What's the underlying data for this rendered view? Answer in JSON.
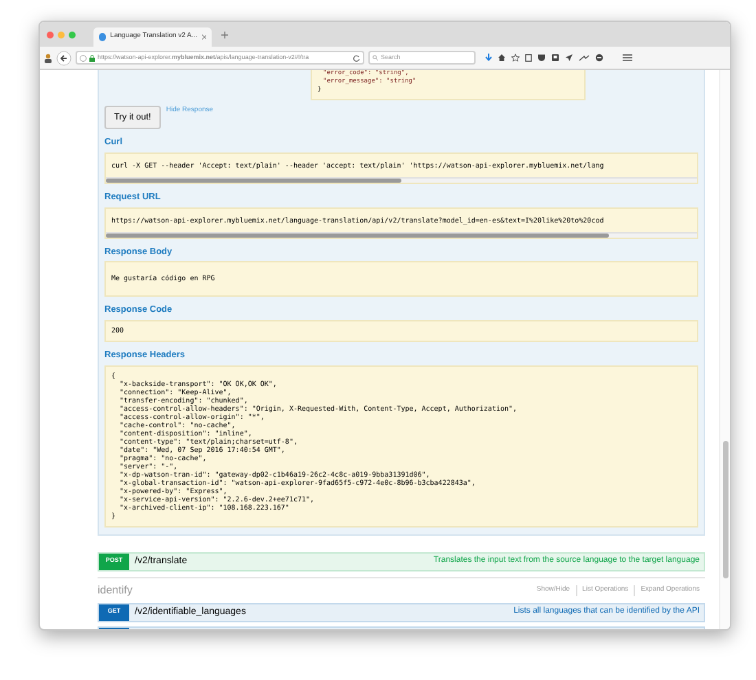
{
  "browser": {
    "tab_title": "Language Translation v2 A...",
    "url": "https://watson-api-explorer.**mybluemix.net**/apis/language-translation-v2#!/tra",
    "search": {
      "placeholder": "Search"
    }
  },
  "model_tail": [
    "\"error_code\": \"string\",",
    "\"error_message\": \"string\"",
    "}"
  ],
  "try_button": "Try it out!",
  "hide_link": "Hide Response",
  "sections": [
    {
      "label": "Curl",
      "kind": "scroll",
      "lines": [
        "curl -X GET --header 'Accept: text/plain' --header 'accept: text/plain' 'https://watson-api-explorer.mybluemix.net/lang"
      ],
      "level": 0.5
    },
    {
      "label": "Request URL",
      "kind": "scroll",
      "lines": [
        "https://watson-api-explorer.mybluemix.net/language-translation/api/v2/translate?model_id=en-es&text=I%20like%20to%20cod"
      ],
      "level": 0.85
    },
    {
      "label": "Response Body",
      "kind": "body",
      "lines": [
        "Me gustaría código en RPG"
      ]
    },
    {
      "label": "Response Code",
      "kind": "plain",
      "lines": [
        "200"
      ]
    },
    {
      "label": "Response Headers",
      "kind": "plain",
      "lines": [
        "{",
        "  \"x-backside-transport\": \"OK OK,OK OK\",",
        "  \"connection\": \"Keep-Alive\",",
        "  \"transfer-encoding\": \"chunked\",",
        "  \"access-control-allow-headers\": \"Origin, X-Requested-With, Content-Type, Accept, Authorization\",",
        "  \"access-control-allow-origin\": \"*\",",
        "  \"cache-control\": \"no-cache\",",
        "  \"content-disposition\": \"inline\",",
        "  \"content-type\": \"text/plain;charset=utf-8\",",
        "  \"date\": \"Wed, 07 Sep 2016 17:40:54 GMT\",",
        "  \"pragma\": \"no-cache\",",
        "  \"server\": \"-\",",
        "  \"x-dp-watson-tran-id\": \"gateway-dp02-c1b46a19-26c2-4c8c-a019-9bba31391d06\",",
        "  \"x-global-transaction-id\": \"watson-api-explorer-9fad65f5-c972-4e0c-8b96-b3cba422843a\",",
        "  \"x-powered-by\": \"Express\",",
        "  \"x-service-api-version\": \"2.2.6-dev.2+ee71c71\",",
        "  \"x-archived-client-ip\": \"108.168.223.167\"",
        "}"
      ]
    }
  ],
  "operation": {
    "method": "POST",
    "path": "/v2/translate",
    "description": "Translates the input text from the source language to the target language"
  },
  "group": {
    "title": "identify",
    "links": [
      "Show/Hide",
      "List Operations",
      "Expand Operations"
    ],
    "operations": [
      {
        "method": "GET",
        "path": "/v2/identifiable_languages",
        "description": "Lists all languages that can be identified by the API"
      }
    ]
  }
}
